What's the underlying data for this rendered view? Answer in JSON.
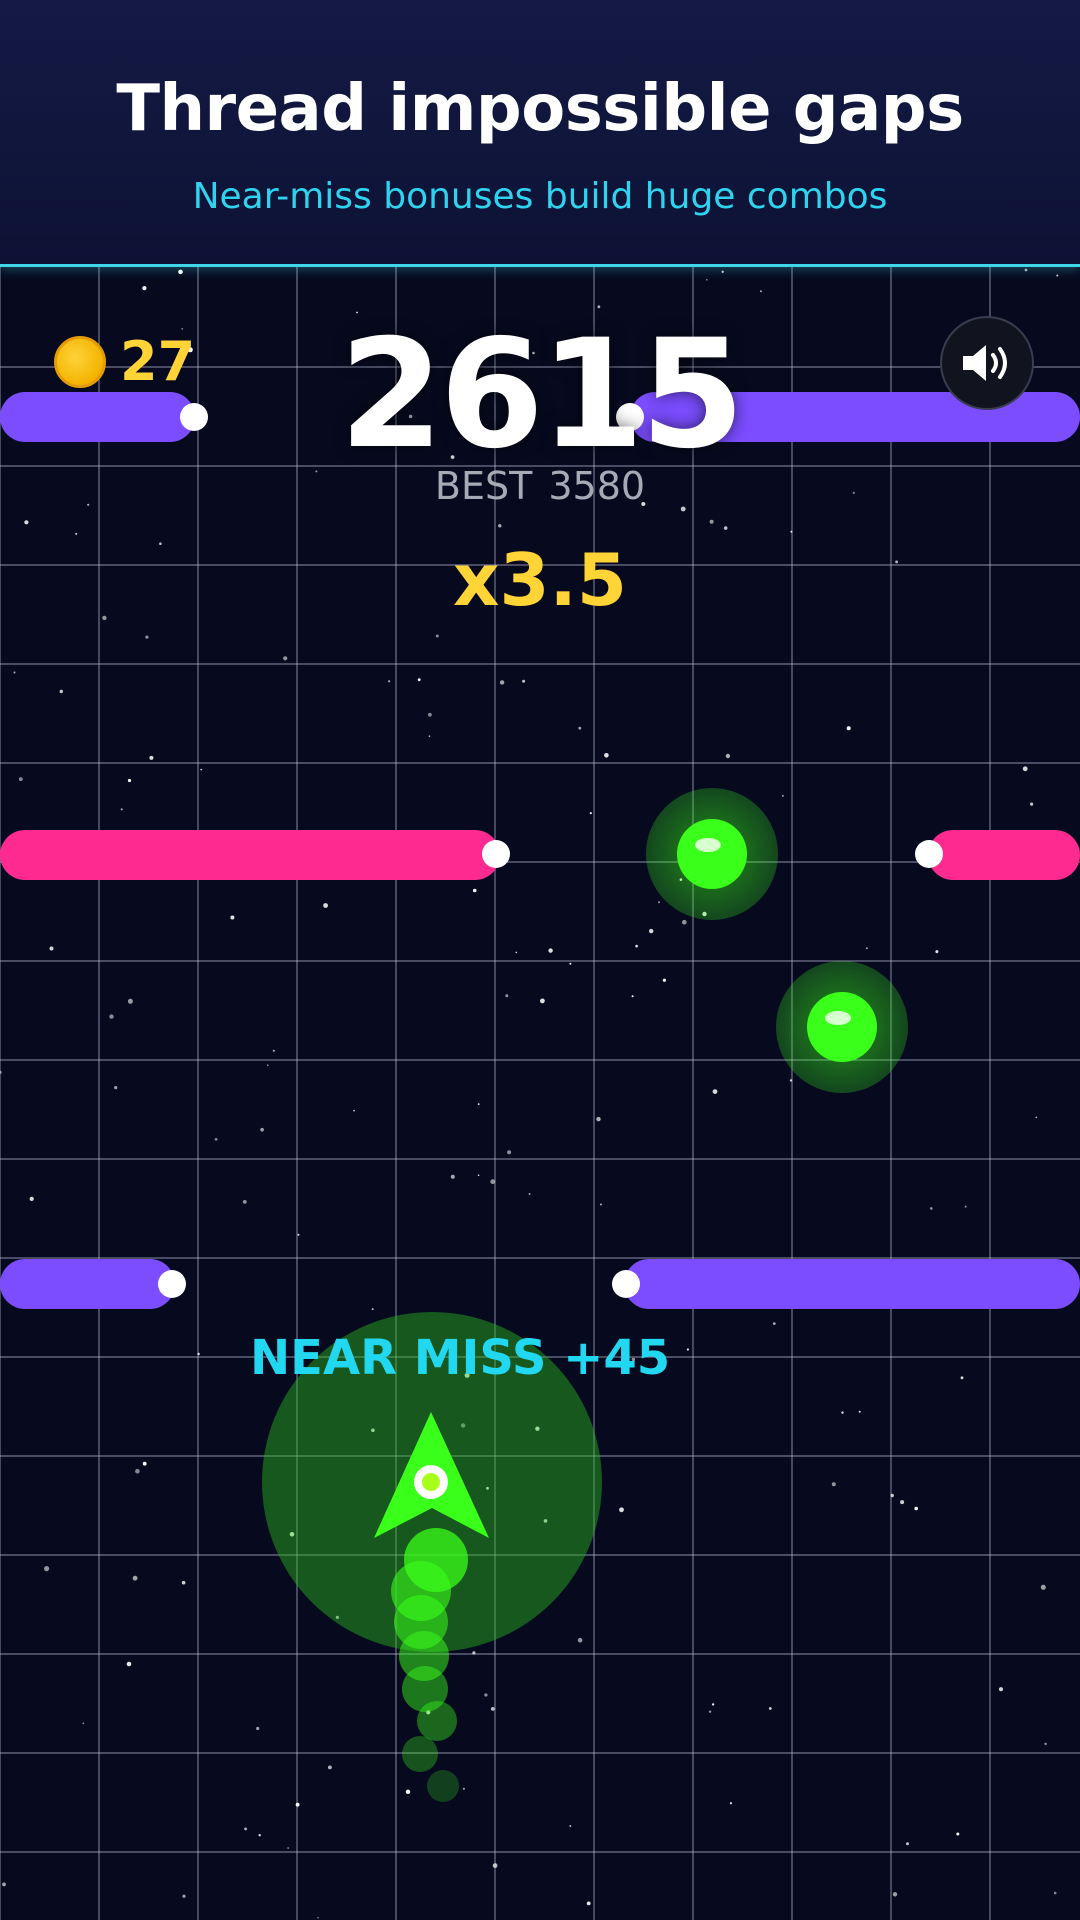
{
  "banner": {
    "title": "Thread impossible gaps",
    "subtitle": "Near-miss bonuses build huge combos"
  },
  "hud": {
    "coins": "27",
    "score": "2615",
    "best_label": "BEST",
    "best_value": "3580",
    "multiplier": "x3.5",
    "sound_icon": "speaker-volume-icon"
  },
  "popup": {
    "text": "NEAR MISS +45"
  },
  "colors": {
    "background": "#070a1f",
    "banner": "#141a44",
    "accent_cyan": "#2fd3ee",
    "gold": "#ffd437",
    "barrier_purple": "#7b4dff",
    "barrier_pink": "#ff2a8f",
    "player_green": "#3aff1a"
  }
}
